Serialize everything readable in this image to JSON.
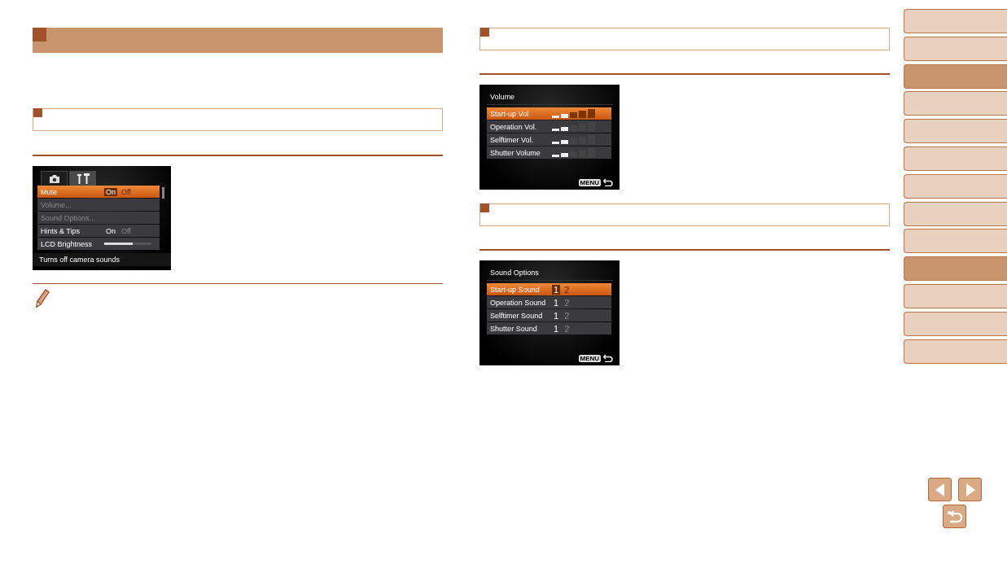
{
  "screens": [
    {
      "kind": "setup_menu",
      "tabs": [
        {
          "kind": "camera",
          "selected": false
        },
        {
          "kind": "tools",
          "selected": true
        }
      ],
      "rows": [
        {
          "label": "Mute",
          "kind": "options",
          "selected": true,
          "disabled": false,
          "options": [
            {
              "label": "On",
              "selected": true
            },
            {
              "label": "Off",
              "selected": false
            }
          ]
        },
        {
          "label": "Volume...",
          "kind": "plain",
          "selected": false,
          "disabled": true
        },
        {
          "label": "Sound Options...",
          "kind": "plain",
          "selected": false,
          "disabled": true
        },
        {
          "label": "Hints & Tips",
          "kind": "options",
          "selected": false,
          "disabled": false,
          "options": [
            {
              "label": "On",
              "selected": true
            },
            {
              "label": "Off",
              "selected": false
            }
          ]
        },
        {
          "label": "LCD Brightness",
          "kind": "slider",
          "selected": false,
          "disabled": false,
          "level": 0.6
        }
      ],
      "hint": "Turns off camera sounds"
    },
    {
      "kind": "list",
      "title": "Volume",
      "rows": [
        {
          "label": "Start-up Vol.",
          "kind": "bars",
          "selected": true,
          "level": 0.4
        },
        {
          "label": "Operation Vol.",
          "kind": "bars",
          "selected": false,
          "level": 0.4
        },
        {
          "label": "Selftimer Vol.",
          "kind": "bars",
          "selected": false,
          "level": 0.4
        },
        {
          "label": "Shutter Volume",
          "kind": "bars",
          "selected": false,
          "level": 0.4
        }
      ],
      "menu_key": "MENU"
    },
    {
      "kind": "list",
      "title": "Sound Options",
      "rows": [
        {
          "label": "Start-up Sound",
          "kind": "options",
          "selected": true,
          "options": [
            {
              "label": "1",
              "selected": true
            },
            {
              "label": "2",
              "selected": false
            }
          ]
        },
        {
          "label": "Operation Sound",
          "kind": "options",
          "selected": false,
          "options": [
            {
              "label": "1",
              "selected": true
            },
            {
              "label": "2",
              "selected": false
            }
          ]
        },
        {
          "label": "Selftimer Sound",
          "kind": "options",
          "selected": false,
          "options": [
            {
              "label": "1",
              "selected": true
            },
            {
              "label": "2",
              "selected": false
            }
          ]
        },
        {
          "label": "Shutter Sound",
          "kind": "options",
          "selected": false,
          "options": [
            {
              "label": "1",
              "selected": true
            },
            {
              "label": "2",
              "selected": false
            }
          ]
        }
      ],
      "menu_key": "MENU"
    }
  ],
  "side_tabs": [
    {
      "selected": false
    },
    {
      "selected": false
    },
    {
      "selected": true
    },
    {
      "selected": false
    },
    {
      "selected": false
    },
    {
      "selected": false
    },
    {
      "selected": false
    },
    {
      "selected": false
    },
    {
      "selected": false
    },
    {
      "selected": true
    },
    {
      "selected": false
    },
    {
      "selected": false
    },
    {
      "selected": false
    }
  ]
}
